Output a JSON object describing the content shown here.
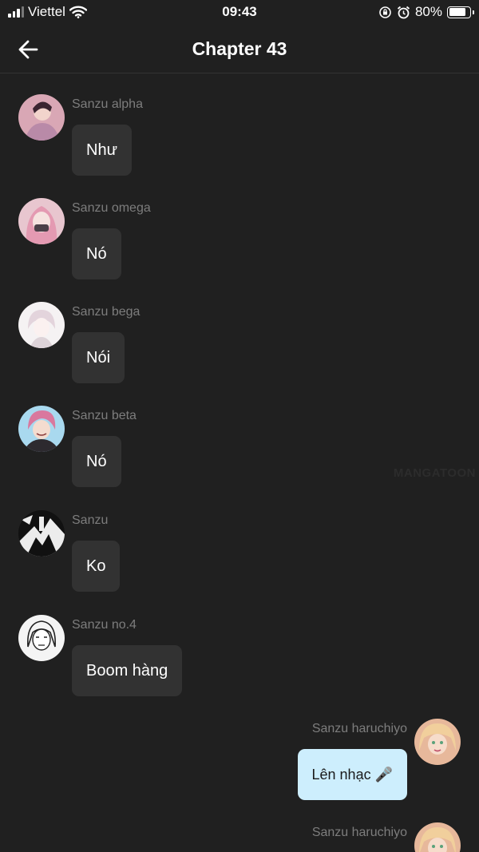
{
  "status_bar": {
    "carrier": "Viettel",
    "time": "09:43",
    "battery": "80%",
    "battery_level": 0.8,
    "icons": [
      "signal-icon",
      "wifi-icon",
      "orientation-lock-icon",
      "alarm-icon",
      "battery-icon"
    ]
  },
  "header": {
    "title": "Chapter 43",
    "back_icon": "arrow-left-icon"
  },
  "messages": [
    {
      "sender": "Sanzu alpha",
      "text": "Như",
      "direction": "incoming"
    },
    {
      "sender": "Sanzu omega",
      "text": "Nó",
      "direction": "incoming"
    },
    {
      "sender": "Sanzu bega",
      "text": "Nói",
      "direction": "incoming"
    },
    {
      "sender": "Sanzu beta",
      "text": "Nó",
      "direction": "incoming"
    },
    {
      "sender": "Sanzu",
      "text": "Ko",
      "direction": "incoming"
    },
    {
      "sender": "Sanzu no.4",
      "text": "Boom hàng",
      "direction": "incoming"
    },
    {
      "sender": "Sanzu haruchiyo",
      "text": "Lên nhạc 🎤",
      "direction": "outgoing"
    },
    {
      "sender": "Sanzu haruchiyo",
      "text": "",
      "direction": "outgoing"
    }
  ],
  "watermark": "MANGATOON",
  "colors": {
    "background": "#202020",
    "bubble_incoming": "#323232",
    "bubble_outgoing": "#cdeefd",
    "sender_text": "#7d7d7d"
  }
}
